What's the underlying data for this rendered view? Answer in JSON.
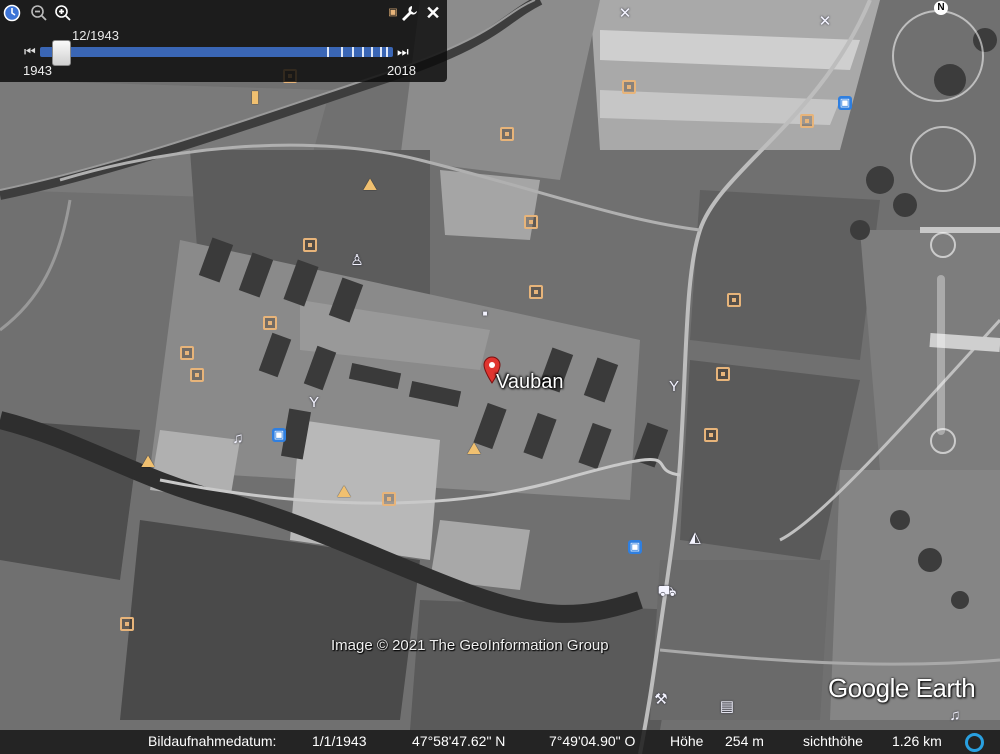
{
  "time_slider": {
    "current_date": "12/1943",
    "start_year": "1943",
    "end_year": "2018",
    "icons": {
      "clock": "clock-icon",
      "zoom_out": "zoom-out-icon",
      "zoom_in": "zoom-in-icon",
      "settings": "wrench-icon",
      "close": "close-icon",
      "back": "step-back-icon",
      "forward": "step-forward-icon"
    }
  },
  "place": {
    "label": "Vauban"
  },
  "attribution": "Image © 2021 The GeoInformation Group",
  "logo": "Google Earth",
  "status_bar": {
    "imagery_date_label": "Bildaufnahmedatum:",
    "imagery_date": "1/1/1943",
    "latitude": "47°58'47.62\" N",
    "longitude": "7°49'04.90\" O",
    "elevation_label": "Höhe",
    "elevation": "254 m",
    "eye_alt_label": "sichthöhe",
    "eye_alt": "1.26 km"
  },
  "navigation": {
    "north_label": "N"
  },
  "colors": {
    "panel_bg": "#0a0a0a",
    "slider_blue": "#3a66b5",
    "poi_orange": "#e7b47a",
    "poi_blue": "#2f7fe0",
    "pin_red": "#e0342f",
    "status_ring": "#29a0e0"
  }
}
